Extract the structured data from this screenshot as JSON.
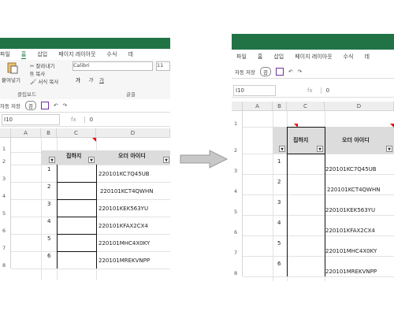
{
  "left": {
    "menu": [
      "파일",
      "홈",
      "삽입",
      "페이지 레이아웃",
      "수식",
      "데"
    ],
    "active_menu_index": 1,
    "ribbon": {
      "paste": "붙여넣기",
      "cut": "잘라내기",
      "copy": "복사",
      "format_painter": "서식 복사",
      "clipboard_group": "클립보드",
      "font_name": "Calibri",
      "font_size": "11",
      "font_group": "글꼴",
      "bold": "가",
      "italic": "가",
      "underline": "가"
    },
    "quick_access": {
      "autosave": "자동 저장",
      "toggle": "끔"
    },
    "formula_bar": {
      "namebox": "I10",
      "fx": "fx",
      "value": "0"
    },
    "col_headers": [
      "A",
      "B",
      "C",
      "D"
    ],
    "row_headers": [
      "1",
      "2",
      "3",
      "4",
      "5",
      "6",
      "7",
      "8"
    ],
    "header_c": "집하지",
    "header_d": "오더 아이디",
    "b_values": [
      "1",
      "2",
      "3",
      "4",
      "5",
      "6"
    ],
    "d_values": [
      "220101KC7Q45UB",
      "220101KCT4QWHN",
      "220101KEK563YU",
      "220101KFAX2CX4",
      "220101MHC4X0KY",
      "220101MREKVNPP"
    ]
  },
  "right": {
    "menu": [
      "파일",
      "홈",
      "삽입",
      "페이지 레이아웃",
      "수식",
      "데"
    ],
    "quick_access": {
      "autosave": "자동 저장",
      "toggle": "끔"
    },
    "formula_bar": {
      "namebox": "I10",
      "fx": "fx",
      "value": "0"
    },
    "col_headers": [
      "A",
      "B",
      "C",
      "D"
    ],
    "row_headers": [
      "1",
      "2",
      "3",
      "4",
      "5",
      "6",
      "7",
      "8"
    ],
    "header_c": "집하지",
    "header_d": "오더 아이디",
    "b_values": [
      "1",
      "2",
      "3",
      "4",
      "5",
      "6"
    ],
    "d_values": [
      "220101KC7Q45UB",
      "220101KCT4QWHN",
      "220101KEK563YU",
      "220101KFAX2CX4",
      "220101MHC4X0KY",
      "220101MREKVNPP"
    ]
  },
  "colors": {
    "excel_green": "#217346",
    "arrow_gray": "#c8c8c8",
    "comment_red": "#e00000"
  },
  "icons": [
    "arrow-right-icon",
    "paste-icon",
    "cut-icon",
    "copy-icon",
    "save-icon",
    "undo-icon",
    "redo-icon",
    "filter-dropdown-icon"
  ]
}
